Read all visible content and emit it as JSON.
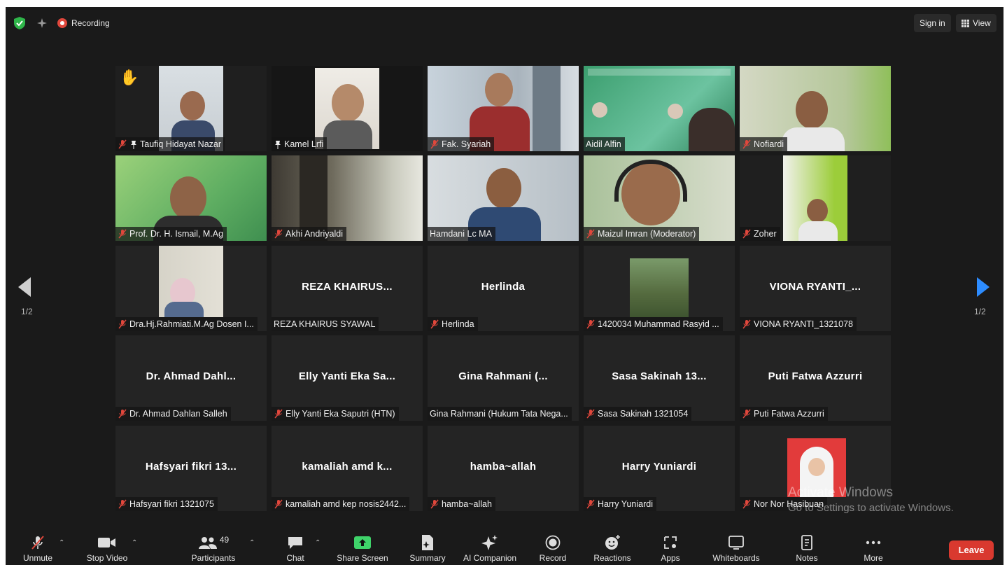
{
  "topbar": {
    "recording": "Recording",
    "sign_in": "Sign in",
    "view": "View"
  },
  "pager": {
    "left": "1/2",
    "right": "1/2"
  },
  "tiles": [
    {
      "label": "Taufiq Hidayat Nazar",
      "center": ""
    },
    {
      "label": "Kamel Lrfi",
      "center": ""
    },
    {
      "label": "Fak. Syariah",
      "center": ""
    },
    {
      "label": "Aidil Alfin",
      "center": ""
    },
    {
      "label": "Nofiardi",
      "center": ""
    },
    {
      "label": "Prof. Dr. H. Ismail, M.Ag",
      "center": ""
    },
    {
      "label": "Akhi Andriyaldi",
      "center": ""
    },
    {
      "label": "Hamdani Lc MA",
      "center": ""
    },
    {
      "label": "Maizul Imran (Moderator)",
      "center": ""
    },
    {
      "label": "Zoher",
      "center": ""
    },
    {
      "label": "Dra.Hj.Rahmiati.M.Ag Dosen I...",
      "center": ""
    },
    {
      "label": "REZA KHAIRUS SYAWAL",
      "center": "REZA KHAIRUS..."
    },
    {
      "label": "Herlinda",
      "center": "Herlinda"
    },
    {
      "label": "1420034 Muhammad Rasyid ...",
      "center": ""
    },
    {
      "label": "VIONA RYANTI_1321078",
      "center": "VIONA RYANTI_..."
    },
    {
      "label": "Dr. Ahmad Dahlan Salleh",
      "center": "Dr. Ahmad Dahl..."
    },
    {
      "label": "Elly Yanti Eka Saputri (HTN)",
      "center": "Elly Yanti Eka Sa..."
    },
    {
      "label": "Gina Rahmani (Hukum Tata Nega...",
      "center": "Gina Rahmani (..."
    },
    {
      "label": "Sasa Sakinah 1321054",
      "center": "Sasa Sakinah 13..."
    },
    {
      "label": "Puti Fatwa Azzurri",
      "center": "Puti Fatwa Azzurri"
    },
    {
      "label": "Hafsyari fikri 1321075",
      "center": "Hafsyari fikri 13..."
    },
    {
      "label": "kamaliah amd kep nosis2442...",
      "center": "kamaliah amd k..."
    },
    {
      "label": "hamba~allah",
      "center": "hamba~allah"
    },
    {
      "label": "Harry Yuniardi",
      "center": "Harry Yuniardi"
    },
    {
      "label": "Nor Nor Hasibuan",
      "center": ""
    }
  ],
  "watermark": {
    "line1": "Activate Windows",
    "line2": "Go to Settings to activate Windows."
  },
  "toolbar": {
    "unmute": "Unmute",
    "stop_video": "Stop Video",
    "participants": "Participants",
    "participants_count": "49",
    "chat": "Chat",
    "share_screen": "Share Screen",
    "summary": "Summary",
    "ai_companion": "AI Companion",
    "record": "Record",
    "reactions": "Reactions",
    "apps": "Apps",
    "whiteboards": "Whiteboards",
    "notes": "Notes",
    "more": "More",
    "leave": "Leave"
  },
  "colors": {
    "accent_blue": "#2d8cff",
    "leave_red": "#d9392f",
    "active_speaker": "#d8e07a",
    "share_green": "#3fd36a",
    "mute_red": "#e0473c"
  }
}
